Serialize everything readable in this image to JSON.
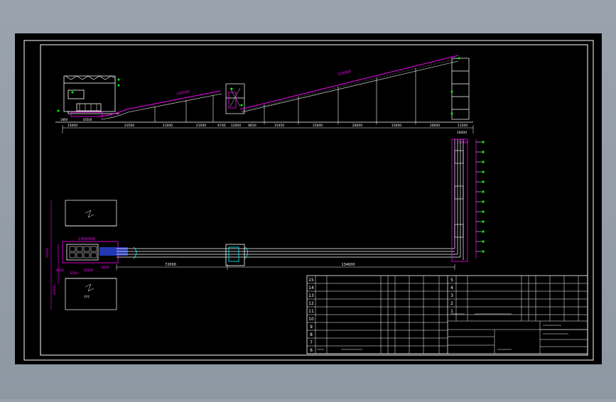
{
  "colors": {
    "frame_bg": "#9aa3ad",
    "canvas": "#000000",
    "border": "#ffffff",
    "magenta": "#ff00ff",
    "white": "#ffffff",
    "green": "#00ff00",
    "cyan": "#00ffff",
    "blue": "#3050ff",
    "yellow": "#ffff00"
  },
  "elevation_dims": [
    "15000",
    "23500",
    "21000",
    "21000",
    "6740",
    "12000",
    "8650",
    "15450",
    "15000",
    "26000",
    "15000",
    "26000",
    "11500"
  ],
  "elevation_belt_labels": [
    "106000",
    "156000"
  ],
  "elevation_small_labels": [
    "16500",
    "1800"
  ],
  "plan_dims": [
    "72000",
    "134000",
    "3900",
    "5500",
    "15500",
    "3600"
  ],
  "plan_right_dims": [
    "16000",
    "51000"
  ],
  "plan_left_dims": [
    "30000",
    "45000"
  ],
  "plan_box_label": "1300/900",
  "plan_bottom_label": "???",
  "title_block": {
    "row_numbers_left": [
      "15",
      "14",
      "13",
      "12",
      "11",
      "10",
      "9",
      "8",
      "7",
      "6"
    ],
    "row_numbers_right": [
      "5",
      "4",
      "3",
      "2",
      "1"
    ]
  }
}
